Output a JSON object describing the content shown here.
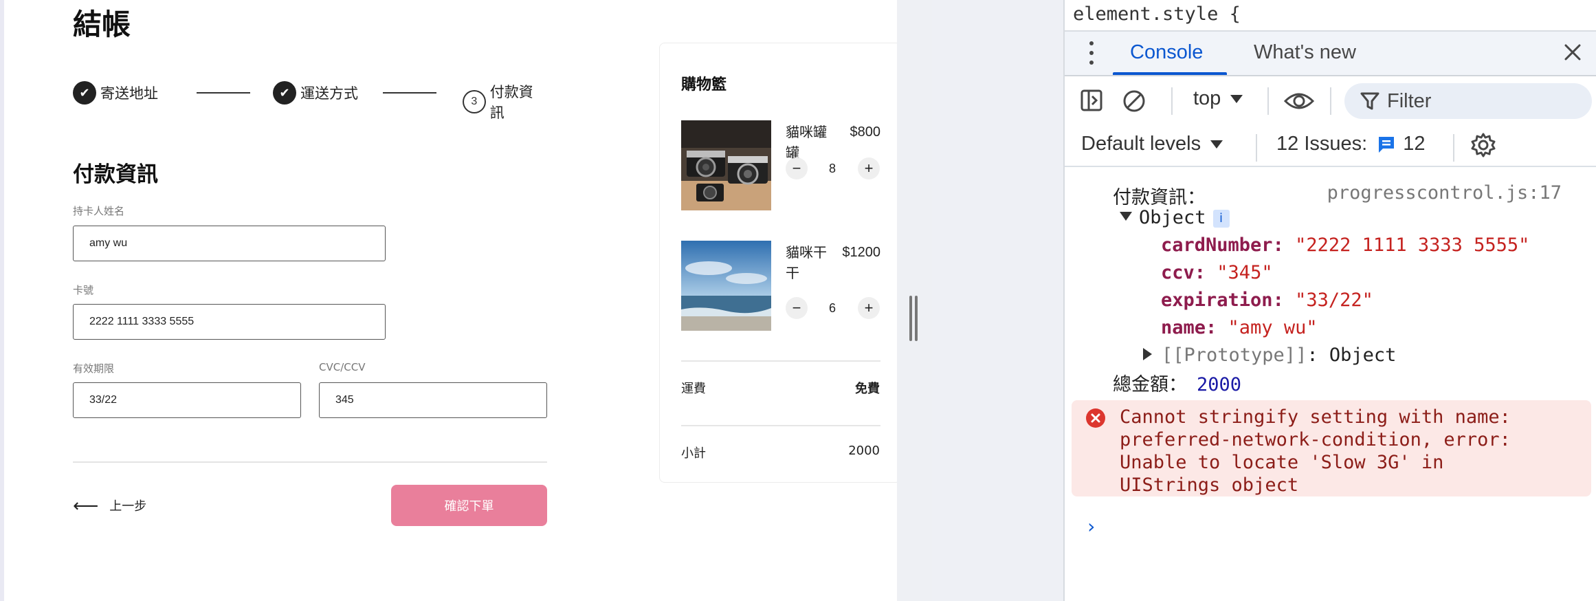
{
  "checkout": {
    "title": "結帳",
    "steps": [
      {
        "label": "寄送地址",
        "done_mark": "✔"
      },
      {
        "label": "運送方式",
        "done_mark": "✔"
      },
      {
        "label": "付款資訊",
        "number": "3"
      }
    ],
    "section_title": "付款資訊",
    "fields": {
      "name": {
        "label": "持卡人姓名",
        "value": "amy wu"
      },
      "card": {
        "label": "卡號",
        "value": "2222 1111 3333 5555"
      },
      "expiry": {
        "label": "有效期限",
        "value": "33/22"
      },
      "cvc": {
        "label": "CVC/CCV",
        "value": "345"
      }
    },
    "back_label": "上一步",
    "back_arrow": "⟵",
    "confirm_label": "確認下單"
  },
  "cart": {
    "title": "購物籃",
    "items": [
      {
        "name": "貓咪罐罐",
        "price": "$800",
        "qty": "8",
        "image": "vintage-cameras-photo"
      },
      {
        "name": "貓咪干干",
        "price": "$1200",
        "qty": "6",
        "image": "ocean-beach-photo"
      }
    ],
    "minus": "−",
    "plus": "+",
    "shipping_label": "運費",
    "shipping_value": "免費",
    "subtotal_label": "小計",
    "subtotal_value": "2000"
  },
  "devtools": {
    "element_style": "element.style {",
    "tabs": [
      "Console",
      "What's new"
    ],
    "context": "top",
    "filter_placeholder": "Filter",
    "levels": "Default levels",
    "issues_label": "12 Issues:",
    "issues_count": "12",
    "log": {
      "label": "付款資訊：",
      "source": "progresscontrol.js:17",
      "object_label": "Object",
      "info_badge": "i",
      "props": [
        {
          "key": "cardNumber",
          "value": "\"2222 1111 3333 5555\""
        },
        {
          "key": "ccv",
          "value": "\"345\""
        },
        {
          "key": "expiration",
          "value": "\"33/22\""
        },
        {
          "key": "name",
          "value": "\"amy wu\""
        }
      ],
      "prototype_key": "[[Prototype]]",
      "prototype_value": ": Object",
      "total_label": "總金額：",
      "total_value": "2000"
    },
    "error": "Cannot stringify setting with name:\npreferred-network-condition, error:\nUnable to locate 'Slow 3G' in\nUIStrings object",
    "prompt": "›",
    "colors": {
      "accent": "#0b57d0",
      "error_bg": "#fce8e6",
      "confirm": "#e97f9b"
    }
  }
}
